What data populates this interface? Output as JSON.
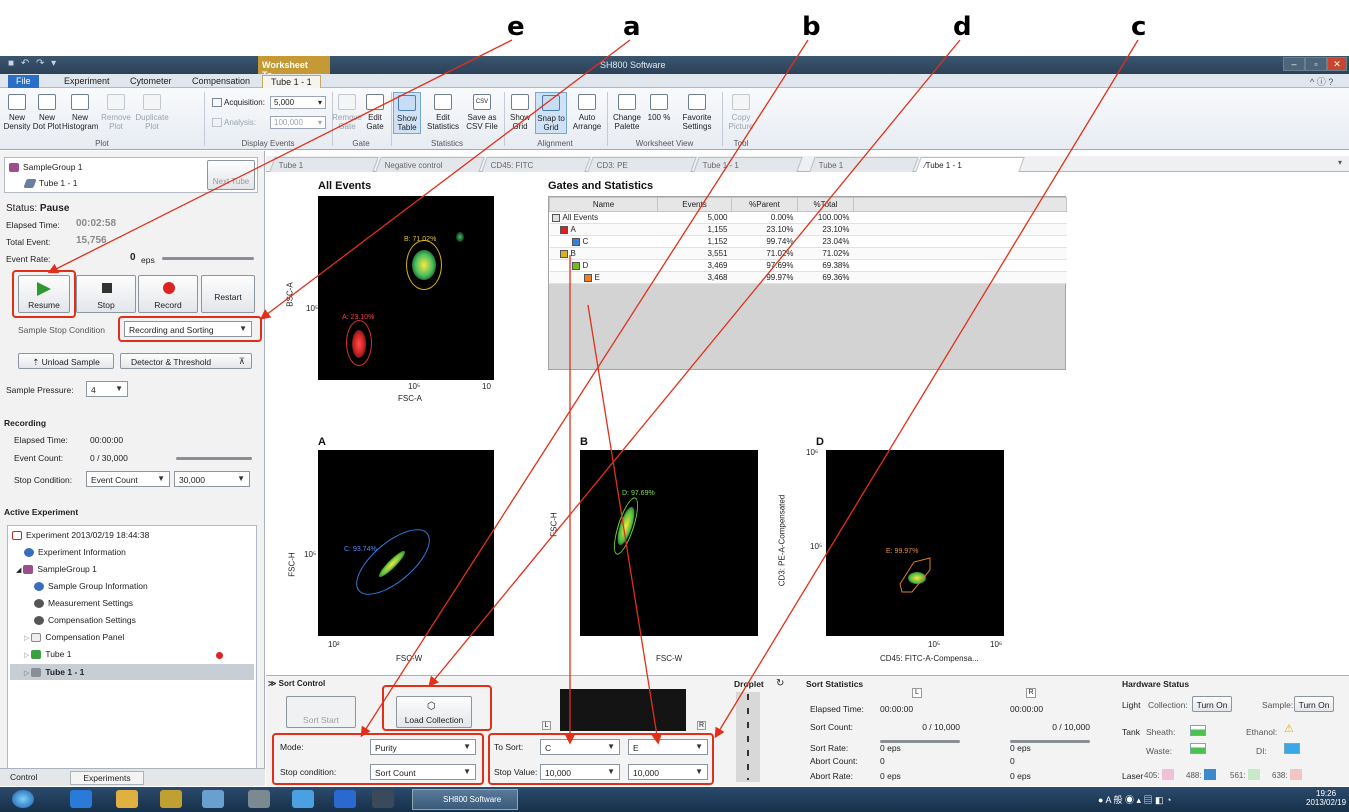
{
  "callouts": {
    "e": "e",
    "a": "a",
    "b": "b",
    "d": "d",
    "c": "c"
  },
  "window": {
    "title": "SH800 Software",
    "context_tab": "Worksheet To..."
  },
  "ribbon_tabs": [
    "File",
    "Experiment",
    "Cytometer",
    "Compensation",
    "Tube 1 - 1"
  ],
  "ribbon": {
    "new_density": "New Density",
    "new_dot_plot": "New Dot Plot",
    "new_histogram": "New Histogram",
    "remove_plot": "Remove Plot",
    "duplicate_plot": "Duplicate Plot",
    "acquisition_label": "Acquisition:",
    "acquisition_value": "5,000",
    "analysis_label": "Analysis:",
    "analysis_value": "100,000",
    "remove_gate": "Remove Gate",
    "edit_gate": "Edit Gate",
    "show_table": "Show Table",
    "edit_statistics": "Edit Statistics",
    "save_csv": "Save as CSV File",
    "csv_icon": "CSV",
    "show_grid": "Show Grid",
    "snap_to_grid": "Snap to Grid",
    "auto_arrange": "Auto Arrange",
    "change_palette": "Change Palette",
    "zoom_100": "100 %",
    "favorite_settings": "Favorite Settings",
    "copy_picture": "Copy Picture",
    "groups": {
      "plot": "Plot",
      "display_events": "Display Events",
      "gate": "Gate",
      "statistics": "Statistics",
      "alignment": "Alignment",
      "worksheet_view": "Worksheet View",
      "tool": "Tool"
    }
  },
  "left": {
    "sample_group": "SampleGroup 1",
    "tube": "Tube 1 - 1",
    "next_tube": "Next Tube",
    "status_label": "Status:",
    "status_value": "Pause",
    "elapsed_label": "Elapsed Time:",
    "elapsed_value": "00:02:58",
    "total_label": "Total Event:",
    "total_value": "15,756",
    "rate_label": "Event Rate:",
    "rate_value": "0",
    "rate_unit": "eps",
    "resume": "Resume",
    "stop": "Stop",
    "record": "Record",
    "restart": "Restart",
    "stop_cond_label": "Sample Stop Condition",
    "stop_cond_value": "Recording and Sorting",
    "unload": "Unload Sample",
    "detector": "Detector & Threshold",
    "pressure_label": "Sample Pressure:",
    "pressure_value": "4",
    "recording_header": "Recording",
    "rec_elapsed_label": "Elapsed Time:",
    "rec_elapsed_value": "00:00:00",
    "rec_count_label": "Event Count:",
    "rec_count_value": "0 / 30,000",
    "rec_stop_label": "Stop Condition:",
    "rec_stop_value": "Event Count",
    "rec_stop_num": "30,000",
    "active_header": "Active Experiment",
    "tree": [
      "Experiment 2013/02/19 18:44:38",
      "Experiment Information",
      "SampleGroup 1",
      "Sample Group Information",
      "Measurement Settings",
      "Compensation Settings",
      "Compensation Panel",
      "Tube 1",
      "Tube 1 - 1"
    ],
    "bottom_tabs": [
      "Control",
      "Experiments"
    ]
  },
  "doc_tabs": [
    "Tube 1",
    "Negative control",
    "CD45: FITC",
    "CD3: PE",
    "Tube 1 - 1",
    "Tube 1",
    "Tube 1 - 1"
  ],
  "plots": {
    "all_events": {
      "title": "All Events",
      "ylabel": "BSC-A",
      "xlabel": "FSC-A",
      "ytick": "10⁵",
      "xtick1": "10⁵",
      "xtick2": "10",
      "gate_a": "A: 23.10%",
      "gate_b": "B: 71.02%"
    },
    "A": {
      "title": "A",
      "ylabel": "FSC-H",
      "xlabel": "FSC-W",
      "ytick": "10⁵",
      "xtick": "10²",
      "gate": "C: 93.74%"
    },
    "B": {
      "title": "B",
      "ylabel": "FSC-H",
      "xlabel": "FSC-W",
      "gate": "D: 97.69%"
    },
    "D": {
      "title": "D",
      "ylabel": "CD3: PE-A-Compensated",
      "xlabel": "CD45: FITC-A-Compensa...",
      "ytick1": "10⁶",
      "ytick2": "10⁵",
      "xtick1": "10⁵",
      "xtick2": "10⁶",
      "gate": "E: 99.97%"
    }
  },
  "gates_stats": {
    "title": "Gates and Statistics",
    "headers": [
      "Name",
      "Events",
      "%Parent",
      "%Total"
    ],
    "rows": [
      {
        "name": "All Events",
        "events": "5,000",
        "parent": "0.00%",
        "total": "100.00%",
        "color": "#e0e0e0"
      },
      {
        "name": "A",
        "events": "1,155",
        "parent": "23.10%",
        "total": "23.10%",
        "color": "#e02020"
      },
      {
        "name": "C",
        "events": "1,152",
        "parent": "99.74%",
        "total": "23.04%",
        "color": "#3a7fd8"
      },
      {
        "name": "B",
        "events": "3,551",
        "parent": "71.02%",
        "total": "71.02%",
        "color": "#d8b020"
      },
      {
        "name": "D",
        "events": "3,469",
        "parent": "97.69%",
        "total": "69.38%",
        "color": "#6cc020"
      },
      {
        "name": "E",
        "events": "3,468",
        "parent": "99.97%",
        "total": "69.36%",
        "color": "#f08020"
      }
    ]
  },
  "sort": {
    "header": "Sort Control",
    "sort_start": "Sort Start",
    "load_collection": "Load Collection",
    "mode_label": "Mode:",
    "mode_value": "Purity",
    "stop_label": "Stop condition:",
    "stop_value": "Sort Count",
    "to_sort_label": "To Sort:",
    "left_gate": "C",
    "right_gate": "E",
    "stop_value_label": "Stop Value:",
    "left_stop": "10,000",
    "right_stop": "10,000",
    "L": "L",
    "R": "R",
    "droplet": "Droplet"
  },
  "sort_stats": {
    "header": "Sort Statistics",
    "L": "L",
    "R": "R",
    "rows": [
      {
        "label": "Elapsed Time:",
        "l": "00:00:00",
        "r": "00:00:00"
      },
      {
        "label": "Sort Count:",
        "l": "0 / 10,000",
        "r": "0 / 10,000"
      },
      {
        "label": "Sort Rate:",
        "l": "0 eps",
        "r": "0 eps"
      },
      {
        "label": "Abort Count:",
        "l": "0",
        "r": "0"
      },
      {
        "label": "Abort Rate:",
        "l": "0 eps",
        "r": "0 eps"
      }
    ]
  },
  "hardware": {
    "header": "Hardware Status",
    "light": "Light",
    "collection": "Collection:",
    "sample": "Sample:",
    "turn_on": "Turn On",
    "tank": "Tank",
    "sheath": "Sheath:",
    "ethanol": "Ethanol:",
    "waste": "Waste:",
    "di": "DI:",
    "laser": "Laser",
    "l405": "405:",
    "l488": "488:",
    "l561": "561:",
    "l638": "638:"
  },
  "taskbar": {
    "app": "SH800 Software",
    "time": "19:26",
    "date": "2013/02/19"
  }
}
